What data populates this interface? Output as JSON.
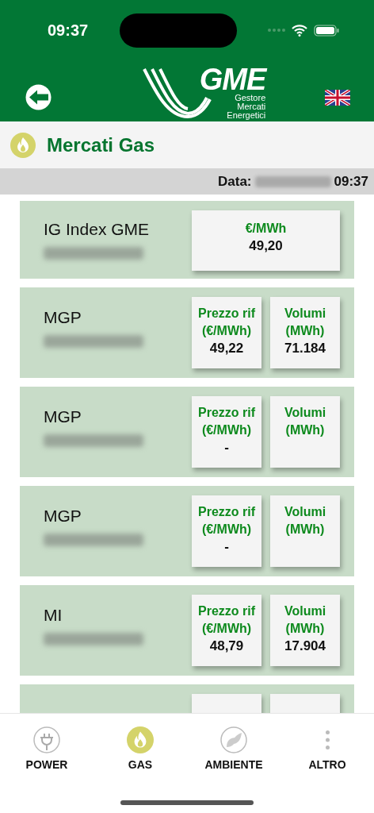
{
  "status_bar": {
    "time": "09:37"
  },
  "logo": {
    "name": "GME",
    "tagline": [
      "Gestore",
      "Mercati",
      "Energetici"
    ]
  },
  "page_title": "Mercati Gas",
  "date_bar": {
    "label": "Data:",
    "time": "09:37"
  },
  "markets": [
    {
      "name": "IG Index GME",
      "cells": [
        {
          "label": "€/MWh",
          "value": "49,20"
        }
      ]
    },
    {
      "name": "MGP",
      "cells": [
        {
          "label": "Prezzo rif (€/MWh)",
          "value": "49,22"
        },
        {
          "label": "Volumi (MWh)",
          "value": "71.184"
        }
      ]
    },
    {
      "name": "MGP",
      "cells": [
        {
          "label": "Prezzo rif (€/MWh)",
          "value": "-"
        },
        {
          "label": "Volumi (MWh)"
        }
      ]
    },
    {
      "name": "MGP",
      "cells": [
        {
          "label": "Prezzo rif (€/MWh)",
          "value": "-"
        },
        {
          "label": "Volumi (MWh)"
        }
      ]
    },
    {
      "name": "MI",
      "cells": [
        {
          "label": "Prezzo rif (€/MWh)",
          "value": "48,79"
        },
        {
          "label": "Volumi (MWh)",
          "value": "17.904"
        }
      ]
    }
  ],
  "tabs": [
    {
      "label": "POWER",
      "kind": "plug",
      "selected": false
    },
    {
      "label": "GAS",
      "kind": "flame",
      "selected": true
    },
    {
      "label": "AMBIENTE",
      "kind": "leaf",
      "selected": false
    },
    {
      "label": "ALTRO",
      "kind": "more",
      "selected": false
    }
  ]
}
